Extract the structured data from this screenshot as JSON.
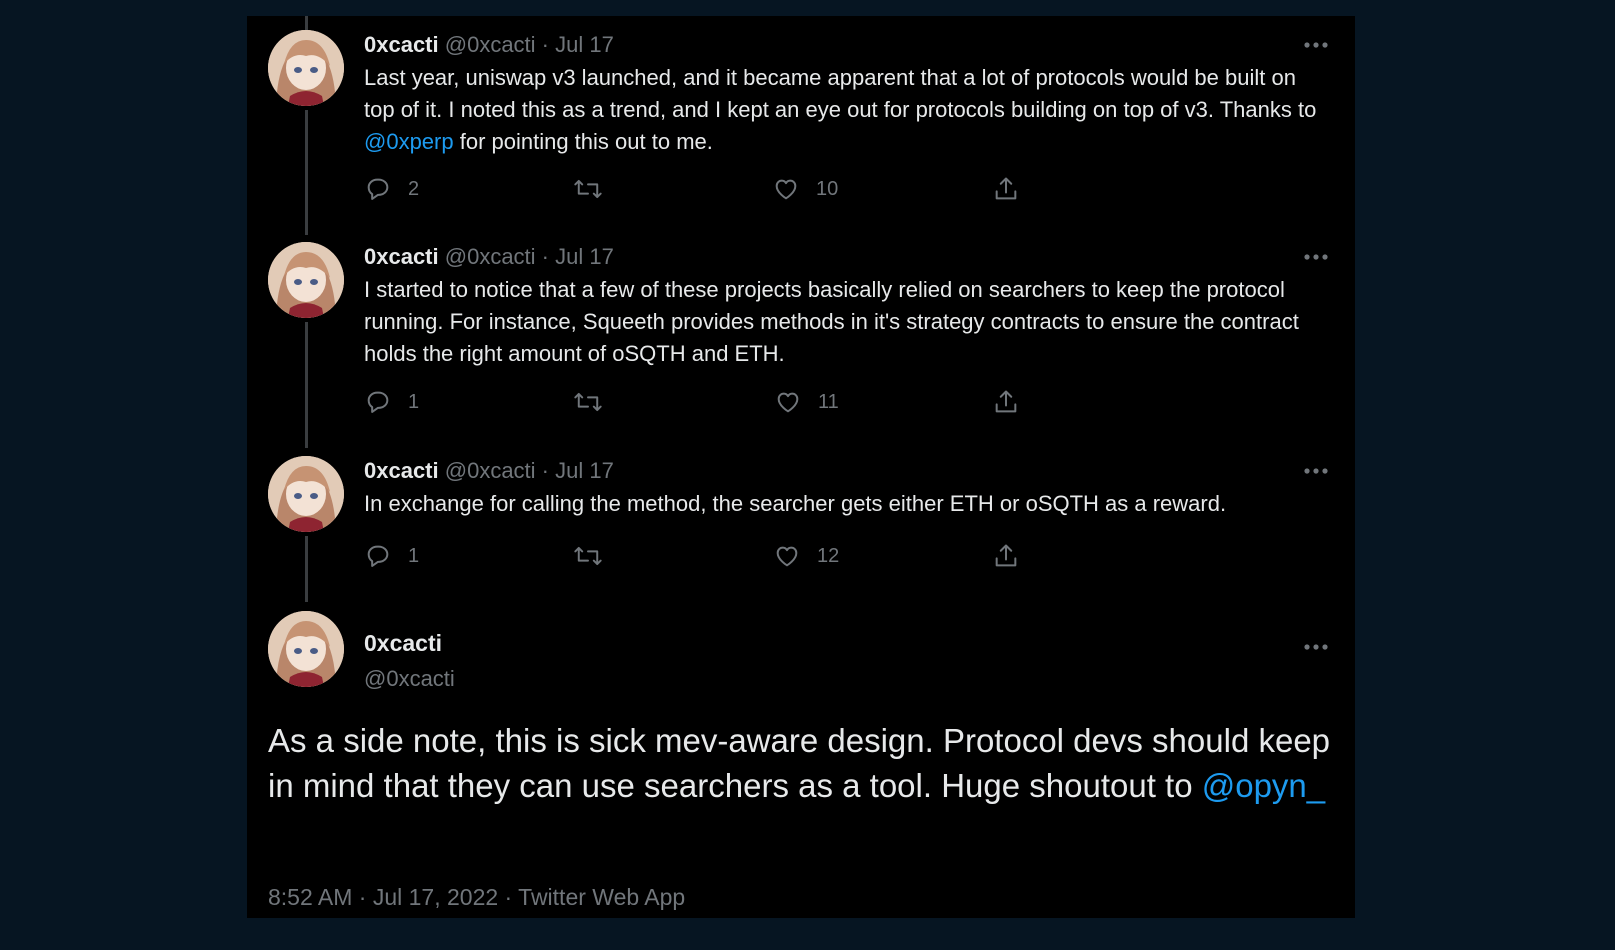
{
  "tweets": [
    {
      "name": "0xcacti",
      "handle": "@0xcacti",
      "sep": " · ",
      "date": "Jul 17",
      "text_before": "Last year, uniswap v3 launched, and it became apparent that a lot of protocols would be built on top of it. I noted this as a trend, and I kept an eye out for protocols building on top of v3. Thanks to ",
      "mention": "@0xperp",
      "text_after": " for pointing this out to me.",
      "replies": "2",
      "retweets": "",
      "likes": "10"
    },
    {
      "name": "0xcacti",
      "handle": "@0xcacti",
      "sep": " · ",
      "date": "Jul 17",
      "text": "I started to notice that a few of these projects basically relied on searchers to keep the protocol running. For instance, Squeeth provides methods in it's strategy contracts to ensure the contract holds the right amount of oSQTH and ETH.",
      "replies": "1",
      "retweets": "",
      "likes": "11"
    },
    {
      "name": "0xcacti",
      "handle": "@0xcacti",
      "sep": " · ",
      "date": "Jul 17",
      "text": "In exchange for calling the method, the searcher gets either ETH or oSQTH as a reward.",
      "replies": "1",
      "retweets": "",
      "likes": "12"
    }
  ],
  "main_tweet": {
    "name": "0xcacti",
    "handle": "@0xcacti",
    "text_before": "As a side note, this is sick mev-aware design.  Protocol devs should keep in mind that they can use searchers as a tool.  Huge shoutout to ",
    "mention": "@opyn_",
    "meta": "8:52 AM · Jul 17, 2022 · Twitter Web App"
  },
  "icons": {
    "reply": "reply-icon",
    "retweet": "retweet-icon",
    "like": "heart-icon",
    "share": "share-icon",
    "more": "more-icon"
  },
  "colors": {
    "background": "#061522",
    "panel": "#000000",
    "link": "#1d9bf0",
    "secondary_text": "#71767b",
    "primary_text": "#e7e9ea"
  }
}
